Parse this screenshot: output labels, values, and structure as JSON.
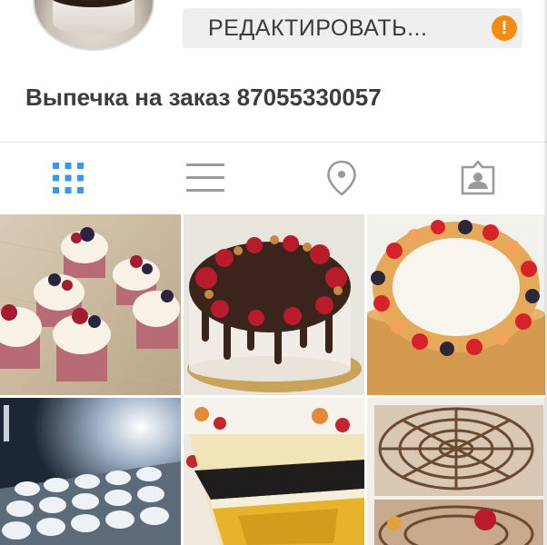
{
  "profile": {
    "edit_button_label": "РЕДАКТИРОВАТЬ...",
    "alert_symbol": "!",
    "name": "Выпечка на заказ 87055330057"
  },
  "tabs": [
    {
      "id": "grid",
      "icon": "grid-icon",
      "active": true
    },
    {
      "id": "list",
      "icon": "list-icon",
      "active": false
    },
    {
      "id": "map",
      "icon": "location-pin-icon",
      "active": false
    },
    {
      "id": "tagged",
      "icon": "tagged-person-icon",
      "active": false
    }
  ],
  "photos": [
    {
      "subject": "cupcakes"
    },
    {
      "subject": "chocolate-drip-cake"
    },
    {
      "subject": "fruit-cake"
    },
    {
      "subject": "meringues"
    },
    {
      "subject": "sliced-layer-cake"
    },
    {
      "subject": "web-pattern-cake"
    }
  ],
  "colors": {
    "accent_blue": "#3897f0",
    "alert_orange": "#f58b12",
    "icon_gray": "#999999",
    "button_bg": "#efefef"
  }
}
